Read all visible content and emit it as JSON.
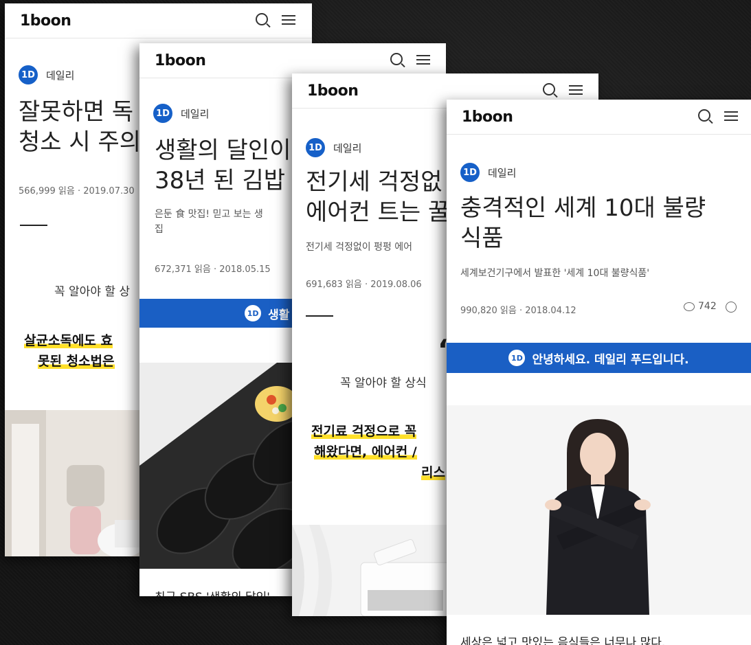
{
  "logo": "1boon",
  "category": "데일리",
  "cat_badge": "1D",
  "cards": [
    {
      "title_lines": [
        "잘못하면 독",
        "청소 시 주의"
      ],
      "meta": "566,999 읽음 · 2019.07.30",
      "quote": "꼭 알아야 할 상",
      "highlight_lines": [
        "살균소독에도 효",
        "못된 청소법은"
      ]
    },
    {
      "title_lines": [
        "생활의 달인이",
        "38년 된 김밥"
      ],
      "subtitle_lines": [
        "은둔 食 맛집! 믿고 보는 생",
        "집"
      ],
      "meta": "672,371 읽음 · 2018.05.15",
      "banner": "생활 속 맛있는",
      "caption": "최근 SBS '생활의 달인'"
    },
    {
      "title_lines": [
        "전기세 걱정없",
        "에어컨 트는 꿀"
      ],
      "subtitle": "전기세 걱정없이 펑펑 에어",
      "meta": "691,683 읽음 · 2019.08.06",
      "quote_mark": "“",
      "quote": "꼭 알아야 할 상식",
      "highlight_lines": [
        "전기료 걱정으로 꼭",
        "해왔다면, 에어컨 /",
        "리스"
      ]
    },
    {
      "title_lines": [
        "충격적인 세계 10대 불량",
        "식품"
      ],
      "subtitle": "세계보건기구에서 발표한 '세계 10대 불량식품'",
      "meta": "990,820 읽음 · 2018.04.12",
      "comments": "742",
      "banner": "안녕하세요. 데일리 푸드입니다.",
      "caption": "세상은 넓고 맛있는 음식들은 너무나 많다."
    }
  ]
}
